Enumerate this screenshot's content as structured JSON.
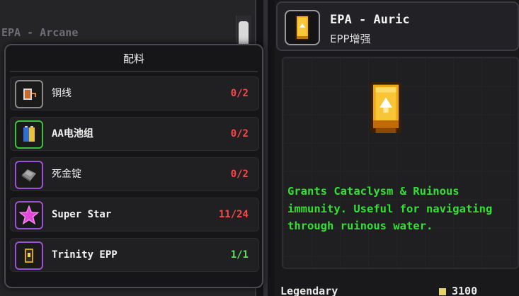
{
  "background_list": {
    "items": [
      {
        "label": "EPA - Arcane"
      }
    ]
  },
  "popup": {
    "title": "配料",
    "ingredients": [
      {
        "name": "铜线",
        "count": "0/2",
        "status": "missing",
        "icon": "copper-wire-icon"
      },
      {
        "name": "AA电池组",
        "count": "0/2",
        "status": "missing",
        "icon": "aa-battery-icon"
      },
      {
        "name": "死金锭",
        "count": "0/2",
        "status": "missing",
        "icon": "dead-gold-ingot-icon"
      },
      {
        "name": "Super Star",
        "count": "11/24",
        "status": "missing",
        "icon": "super-star-icon"
      },
      {
        "name": "Trinity EPP",
        "count": "1/1",
        "status": "complete",
        "icon": "trinity-epp-icon"
      }
    ]
  },
  "detail": {
    "title": "EPA - Auric",
    "subtitle": "EPP增强",
    "description": "Grants Cataclysm & Ruinous immunity. Useful for navigating through ruinous water.",
    "rarity": "Legendary",
    "price": "3100",
    "icon": "epa-auric-icon"
  },
  "colors": {
    "missing": "#ff4646",
    "complete": "#5fe05f",
    "description": "#33e033",
    "auric_gold": "#f2b313"
  }
}
